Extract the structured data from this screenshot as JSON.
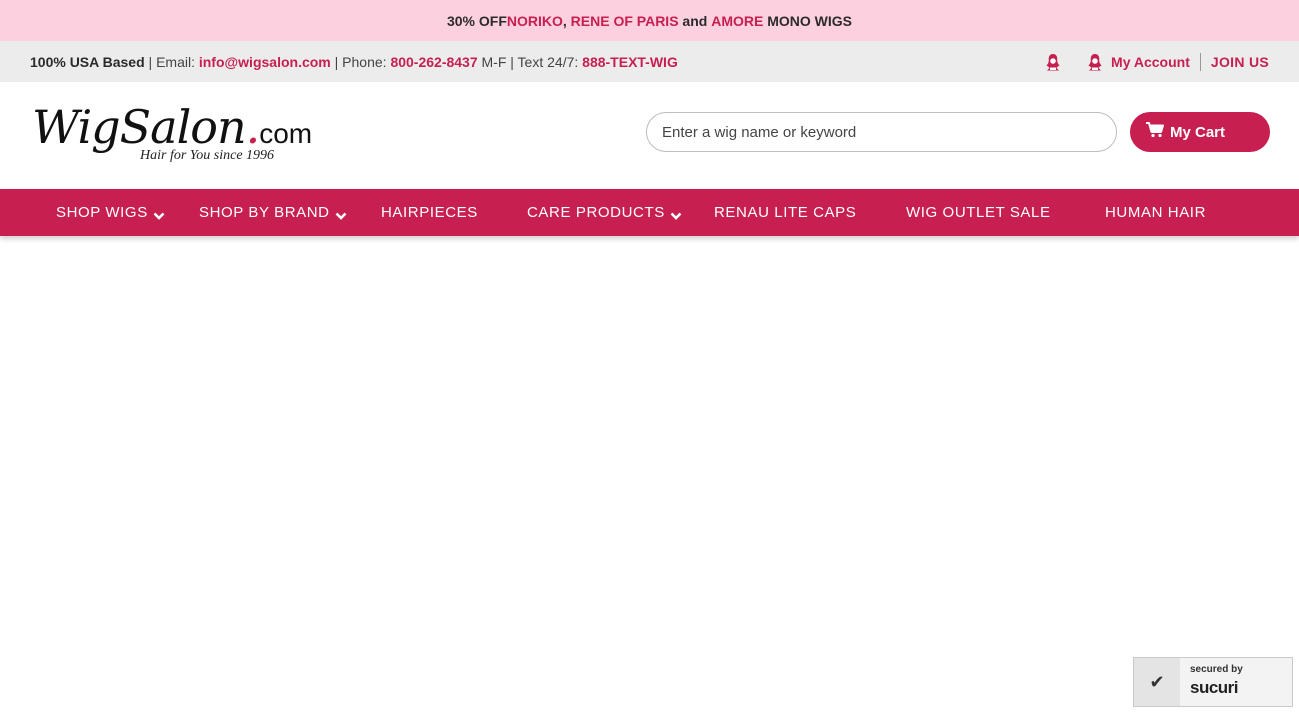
{
  "promo": {
    "prefix": "30% OFF ",
    "brand1": "NORIKO",
    "comma": ", ",
    "brand2": "RENE OF PARIS",
    "and": " and ",
    "brand3": "AMORE",
    "suffix": " MONO WIGS"
  },
  "info": {
    "usa": "100% USA Based",
    "email_label": " | Email: ",
    "email": "info@wigsalon.com",
    "phone_label": " | Phone: ",
    "phone": "800-262-8437",
    "text_label": " M-F | Text 24/7: ",
    "text_number": "888-TEXT-WIG",
    "account": "My Account",
    "join": "JOIN US"
  },
  "header": {
    "logo_main": "WigSalon",
    "logo_dot": ".",
    "logo_com": "com",
    "logo_tagline": "Hair for You since 1996",
    "search_placeholder": "Enter a wig name or keyword",
    "cart_label": "My Cart"
  },
  "nav": {
    "items": [
      {
        "label": "SHOP WIGS",
        "has_dropdown": true
      },
      {
        "label": "SHOP BY BRAND",
        "has_dropdown": true
      },
      {
        "label": "HAIRPIECES",
        "has_dropdown": false
      },
      {
        "label": "CARE PRODUCTS",
        "has_dropdown": true
      },
      {
        "label": "RENAU LITE CAPS",
        "has_dropdown": false
      },
      {
        "label": "WIG OUTLET SALE",
        "has_dropdown": false
      },
      {
        "label": "HUMAN HAIR",
        "has_dropdown": false
      }
    ]
  },
  "badge": {
    "secured_by": "secured by",
    "brand": "sucuri",
    "icon": "checkmark-icon"
  },
  "colors": {
    "accent": "#c71f50",
    "promo_bg": "#fdd0e0",
    "info_bg": "#ececec"
  }
}
